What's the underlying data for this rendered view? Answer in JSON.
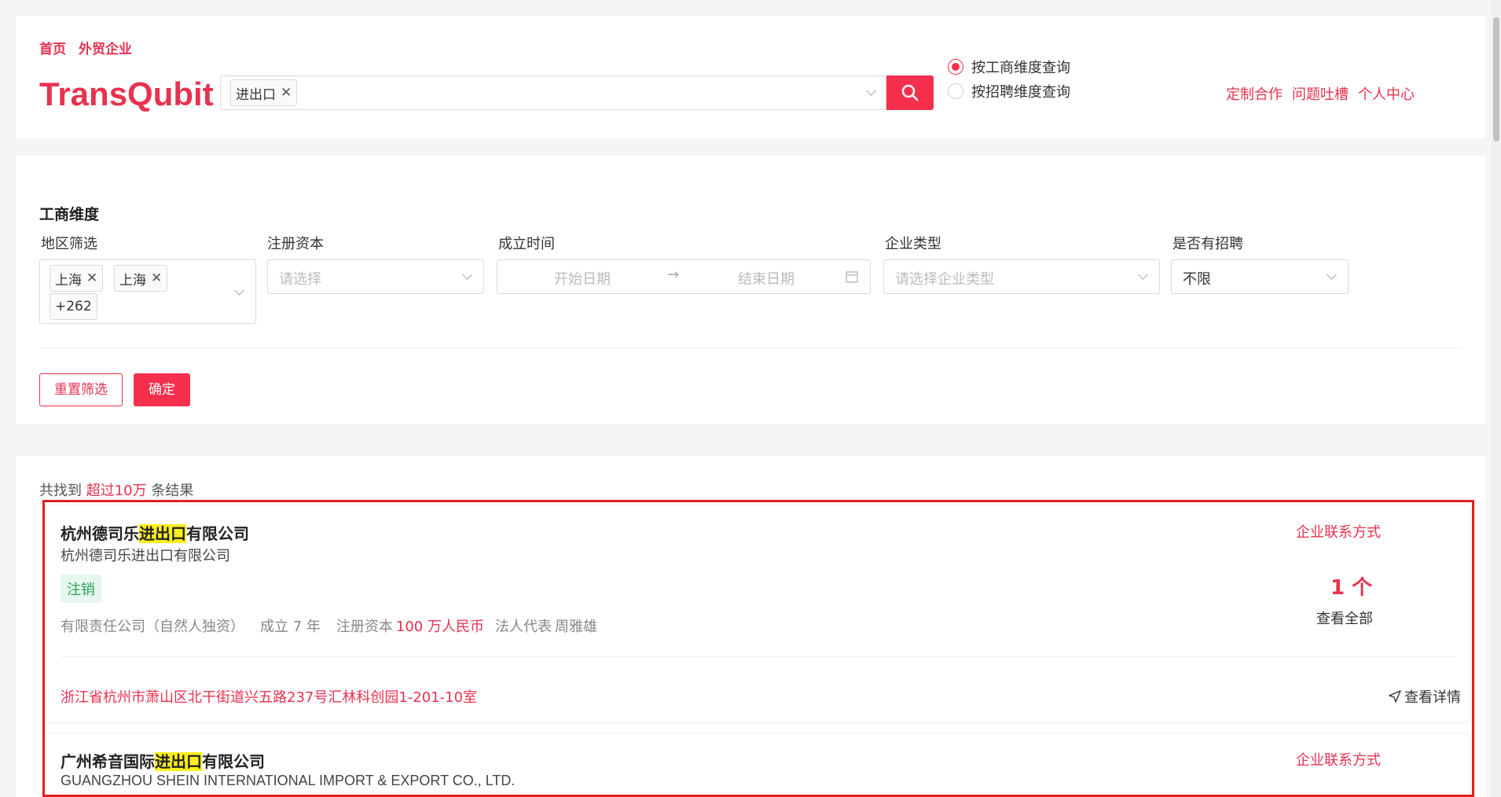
{
  "breadcrumb": [
    "首页",
    "外贸企业"
  ],
  "logo": "TransQubit",
  "search": {
    "tag": "进出口"
  },
  "radios": [
    {
      "label": "按工商维度查询",
      "checked": true
    },
    {
      "label": "按招聘维度查询",
      "checked": false
    }
  ],
  "top_links": [
    "定制合作",
    "问题吐槽",
    "个人中心"
  ],
  "filter": {
    "title": "工商维度",
    "region": {
      "label": "地区筛选",
      "tags": [
        "上海",
        "上海"
      ],
      "more": "+262"
    },
    "capital": {
      "label": "注册资本",
      "placeholder": "请选择"
    },
    "founded": {
      "label": "成立时间",
      "start": "开始日期",
      "end": "结束日期"
    },
    "type": {
      "label": "企业类型",
      "placeholder": "请选择企业类型"
    },
    "hiring": {
      "label": "是否有招聘",
      "value": "不限"
    },
    "reset": "重置筛选",
    "confirm": "确定"
  },
  "results": {
    "prefix": "共找到",
    "count": "超过10万",
    "suffix": "条结果",
    "companies": [
      {
        "name_before": "杭州德司乐",
        "name_highlight": "进出口",
        "name_after": "有限公司",
        "sub": "杭州德司乐进出口有限公司",
        "status": "注销",
        "meta_type": "有限责任公司（自然人独资）",
        "meta_founded": "成立 7 年",
        "meta_capital_label": "注册资本",
        "meta_capital": "100 万人民币",
        "meta_rep_label": "法人代表",
        "meta_rep": "周雅雄",
        "contact": "企业联系方式",
        "contact_count": "1 个",
        "view_all": "查看全部",
        "address": "浙江省杭州市萧山区北干街道兴五路237号汇林科创园1-201-10室",
        "detail": "查看详情"
      },
      {
        "name_before": "广州希音国际",
        "name_highlight": "进出口",
        "name_after": "有限公司",
        "sub": "GUANGZHOU SHEIN INTERNATIONAL IMPORT & EXPORT CO., LTD.",
        "contact": "企业联系方式"
      }
    ]
  }
}
